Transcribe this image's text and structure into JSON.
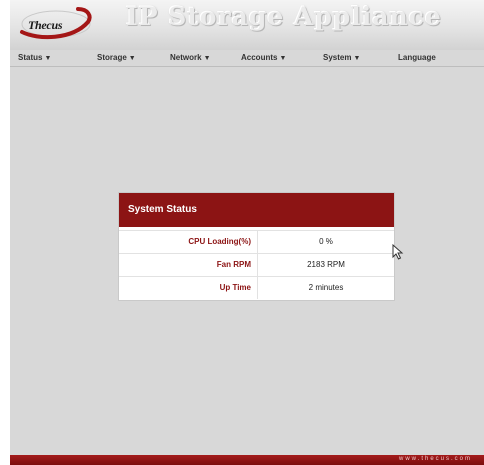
{
  "brand": {
    "logo_text": "Thecus",
    "title": "IP Storage Appliance"
  },
  "nav": {
    "items": [
      {
        "label": "Status",
        "has_dropdown": true
      },
      {
        "label": "Storage",
        "has_dropdown": true
      },
      {
        "label": "Network",
        "has_dropdown": true
      },
      {
        "label": "Accounts",
        "has_dropdown": true
      },
      {
        "label": "System",
        "has_dropdown": true
      },
      {
        "label": "Language",
        "has_dropdown": false
      }
    ],
    "dropdown_icon": "chevron-down-icon"
  },
  "system_status": {
    "title": "System Status",
    "rows": [
      {
        "label": "CPU Loading(%)",
        "value": "0 %"
      },
      {
        "label": "Fan RPM",
        "value": "2183 RPM"
      },
      {
        "label": "Up Time",
        "value": "2 minutes"
      }
    ]
  },
  "footer": {
    "url": "www.thecus.com"
  },
  "colors": {
    "accent": "#8c1414",
    "page_bg": "#d8d8d8",
    "footer": "#9a1818"
  }
}
